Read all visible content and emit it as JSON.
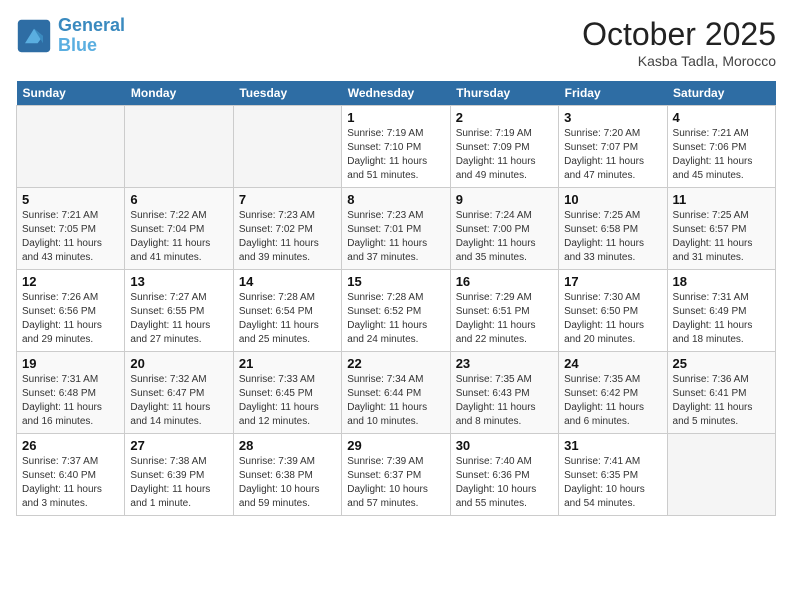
{
  "header": {
    "logo_line1": "General",
    "logo_line2": "Blue",
    "month": "October 2025",
    "location": "Kasba Tadla, Morocco"
  },
  "days_of_week": [
    "Sunday",
    "Monday",
    "Tuesday",
    "Wednesday",
    "Thursday",
    "Friday",
    "Saturday"
  ],
  "weeks": [
    [
      {
        "day": "",
        "sunrise": "",
        "sunset": "",
        "daylight": ""
      },
      {
        "day": "",
        "sunrise": "",
        "sunset": "",
        "daylight": ""
      },
      {
        "day": "",
        "sunrise": "",
        "sunset": "",
        "daylight": ""
      },
      {
        "day": "1",
        "sunrise": "Sunrise: 7:19 AM",
        "sunset": "Sunset: 7:10 PM",
        "daylight": "Daylight: 11 hours and 51 minutes."
      },
      {
        "day": "2",
        "sunrise": "Sunrise: 7:19 AM",
        "sunset": "Sunset: 7:09 PM",
        "daylight": "Daylight: 11 hours and 49 minutes."
      },
      {
        "day": "3",
        "sunrise": "Sunrise: 7:20 AM",
        "sunset": "Sunset: 7:07 PM",
        "daylight": "Daylight: 11 hours and 47 minutes."
      },
      {
        "day": "4",
        "sunrise": "Sunrise: 7:21 AM",
        "sunset": "Sunset: 7:06 PM",
        "daylight": "Daylight: 11 hours and 45 minutes."
      }
    ],
    [
      {
        "day": "5",
        "sunrise": "Sunrise: 7:21 AM",
        "sunset": "Sunset: 7:05 PM",
        "daylight": "Daylight: 11 hours and 43 minutes."
      },
      {
        "day": "6",
        "sunrise": "Sunrise: 7:22 AM",
        "sunset": "Sunset: 7:04 PM",
        "daylight": "Daylight: 11 hours and 41 minutes."
      },
      {
        "day": "7",
        "sunrise": "Sunrise: 7:23 AM",
        "sunset": "Sunset: 7:02 PM",
        "daylight": "Daylight: 11 hours and 39 minutes."
      },
      {
        "day": "8",
        "sunrise": "Sunrise: 7:23 AM",
        "sunset": "Sunset: 7:01 PM",
        "daylight": "Daylight: 11 hours and 37 minutes."
      },
      {
        "day": "9",
        "sunrise": "Sunrise: 7:24 AM",
        "sunset": "Sunset: 7:00 PM",
        "daylight": "Daylight: 11 hours and 35 minutes."
      },
      {
        "day": "10",
        "sunrise": "Sunrise: 7:25 AM",
        "sunset": "Sunset: 6:58 PM",
        "daylight": "Daylight: 11 hours and 33 minutes."
      },
      {
        "day": "11",
        "sunrise": "Sunrise: 7:25 AM",
        "sunset": "Sunset: 6:57 PM",
        "daylight": "Daylight: 11 hours and 31 minutes."
      }
    ],
    [
      {
        "day": "12",
        "sunrise": "Sunrise: 7:26 AM",
        "sunset": "Sunset: 6:56 PM",
        "daylight": "Daylight: 11 hours and 29 minutes."
      },
      {
        "day": "13",
        "sunrise": "Sunrise: 7:27 AM",
        "sunset": "Sunset: 6:55 PM",
        "daylight": "Daylight: 11 hours and 27 minutes."
      },
      {
        "day": "14",
        "sunrise": "Sunrise: 7:28 AM",
        "sunset": "Sunset: 6:54 PM",
        "daylight": "Daylight: 11 hours and 25 minutes."
      },
      {
        "day": "15",
        "sunrise": "Sunrise: 7:28 AM",
        "sunset": "Sunset: 6:52 PM",
        "daylight": "Daylight: 11 hours and 24 minutes."
      },
      {
        "day": "16",
        "sunrise": "Sunrise: 7:29 AM",
        "sunset": "Sunset: 6:51 PM",
        "daylight": "Daylight: 11 hours and 22 minutes."
      },
      {
        "day": "17",
        "sunrise": "Sunrise: 7:30 AM",
        "sunset": "Sunset: 6:50 PM",
        "daylight": "Daylight: 11 hours and 20 minutes."
      },
      {
        "day": "18",
        "sunrise": "Sunrise: 7:31 AM",
        "sunset": "Sunset: 6:49 PM",
        "daylight": "Daylight: 11 hours and 18 minutes."
      }
    ],
    [
      {
        "day": "19",
        "sunrise": "Sunrise: 7:31 AM",
        "sunset": "Sunset: 6:48 PM",
        "daylight": "Daylight: 11 hours and 16 minutes."
      },
      {
        "day": "20",
        "sunrise": "Sunrise: 7:32 AM",
        "sunset": "Sunset: 6:47 PM",
        "daylight": "Daylight: 11 hours and 14 minutes."
      },
      {
        "day": "21",
        "sunrise": "Sunrise: 7:33 AM",
        "sunset": "Sunset: 6:45 PM",
        "daylight": "Daylight: 11 hours and 12 minutes."
      },
      {
        "day": "22",
        "sunrise": "Sunrise: 7:34 AM",
        "sunset": "Sunset: 6:44 PM",
        "daylight": "Daylight: 11 hours and 10 minutes."
      },
      {
        "day": "23",
        "sunrise": "Sunrise: 7:35 AM",
        "sunset": "Sunset: 6:43 PM",
        "daylight": "Daylight: 11 hours and 8 minutes."
      },
      {
        "day": "24",
        "sunrise": "Sunrise: 7:35 AM",
        "sunset": "Sunset: 6:42 PM",
        "daylight": "Daylight: 11 hours and 6 minutes."
      },
      {
        "day": "25",
        "sunrise": "Sunrise: 7:36 AM",
        "sunset": "Sunset: 6:41 PM",
        "daylight": "Daylight: 11 hours and 5 minutes."
      }
    ],
    [
      {
        "day": "26",
        "sunrise": "Sunrise: 7:37 AM",
        "sunset": "Sunset: 6:40 PM",
        "daylight": "Daylight: 11 hours and 3 minutes."
      },
      {
        "day": "27",
        "sunrise": "Sunrise: 7:38 AM",
        "sunset": "Sunset: 6:39 PM",
        "daylight": "Daylight: 11 hours and 1 minute."
      },
      {
        "day": "28",
        "sunrise": "Sunrise: 7:39 AM",
        "sunset": "Sunset: 6:38 PM",
        "daylight": "Daylight: 10 hours and 59 minutes."
      },
      {
        "day": "29",
        "sunrise": "Sunrise: 7:39 AM",
        "sunset": "Sunset: 6:37 PM",
        "daylight": "Daylight: 10 hours and 57 minutes."
      },
      {
        "day": "30",
        "sunrise": "Sunrise: 7:40 AM",
        "sunset": "Sunset: 6:36 PM",
        "daylight": "Daylight: 10 hours and 55 minutes."
      },
      {
        "day": "31",
        "sunrise": "Sunrise: 7:41 AM",
        "sunset": "Sunset: 6:35 PM",
        "daylight": "Daylight: 10 hours and 54 minutes."
      },
      {
        "day": "",
        "sunrise": "",
        "sunset": "",
        "daylight": ""
      }
    ]
  ]
}
